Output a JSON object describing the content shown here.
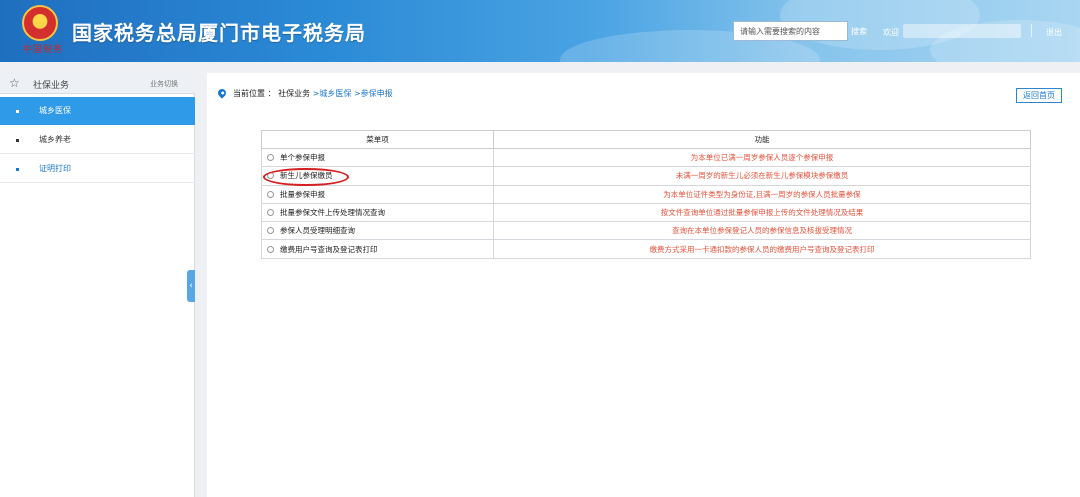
{
  "header": {
    "emblem_caption": "中国税务",
    "title": "国家税务总局厦门市电子税务局",
    "search_placeholder": "请输入需要搜索的内容",
    "search_label": "搜索",
    "welcome": "欢迎",
    "logout": "退出"
  },
  "sidebar": {
    "section_title": "社保业务",
    "switch_label": "业务切换",
    "items": [
      {
        "label": "城乡医保",
        "state": "active"
      },
      {
        "label": "城乡养老",
        "state": "normal"
      },
      {
        "label": "证明打印",
        "state": "link"
      }
    ],
    "collapse_glyph": "‹"
  },
  "breadcrumb": {
    "prefix": "当前位置 ：",
    "root": "社保业务",
    "level1": "城乡医保",
    "level2": "参保申报"
  },
  "back_button": "返回首页",
  "table": {
    "headers": [
      "菜单项",
      "功能"
    ],
    "rows": [
      {
        "menu": "单个参保申报",
        "desc": "为本单位已满一周岁参保人员逐个参保申报"
      },
      {
        "menu": "新生儿参保缴员",
        "desc": "未满一周岁的新生儿必须在新生儿参保模块参保缴员"
      },
      {
        "menu": "批量参保申报",
        "desc": "为本单位证件类型为身份证,且满一周岁的参保人员批量参保"
      },
      {
        "menu": "批量参保文件上传处理情况查询",
        "desc": "按文件查询单位通过批量参保申报上传的文件处理情况及结果"
      },
      {
        "menu": "参保人员受理明细查询",
        "desc": "查询在本单位参保登记人员的参保信息及核拔受理情况"
      },
      {
        "menu": "缴费用户号查询及登记表打印",
        "desc": "缴费方式采用一卡通扣款的参保人员的缴费用户号查询及登记表打印"
      }
    ]
  },
  "colors": {
    "header_start": "#1f6fbf",
    "sidebar_active": "#2f9be8",
    "link_blue": "#1a76c9",
    "desc_red": "#e4513b",
    "annotation_red": "#d61f1f"
  }
}
